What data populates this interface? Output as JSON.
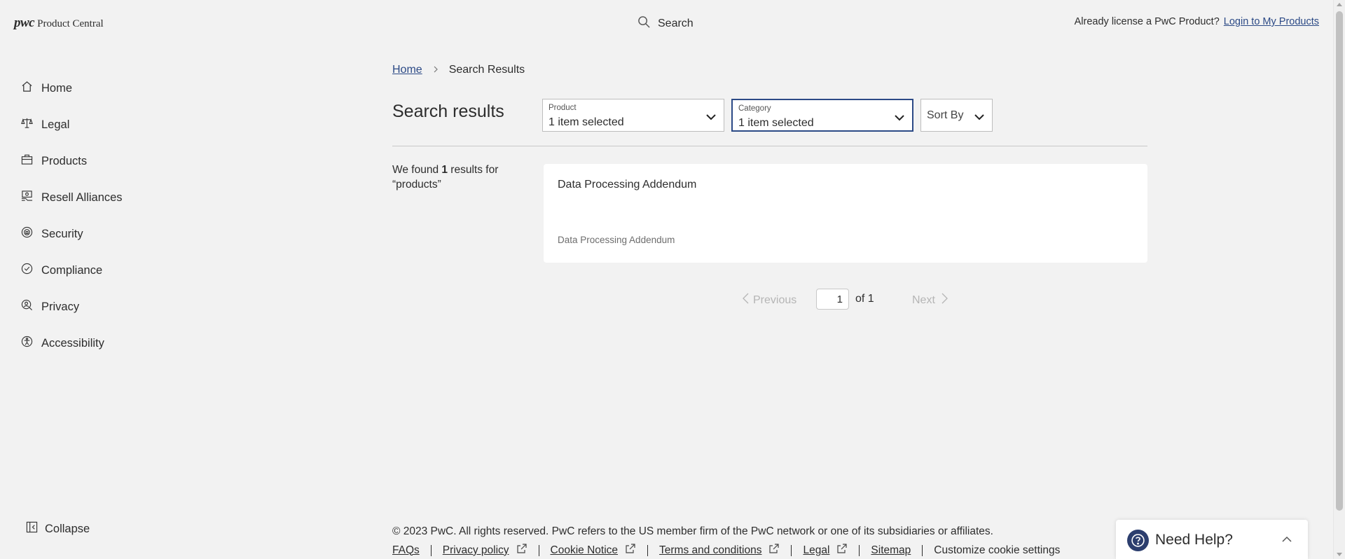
{
  "header": {
    "logo_mark": "pwc",
    "logo_text": "Product Central",
    "search_label": "Search",
    "license_prompt": "Already license a PwC Product?",
    "login_link": "Login to My Products"
  },
  "sidebar": {
    "items": [
      {
        "label": "Home",
        "icon": "home-icon"
      },
      {
        "label": "Legal",
        "icon": "scale-icon"
      },
      {
        "label": "Products",
        "icon": "briefcase-icon"
      },
      {
        "label": "Resell Alliances",
        "icon": "handshake-icon"
      },
      {
        "label": "Security",
        "icon": "shield-icon"
      },
      {
        "label": "Compliance",
        "icon": "check-circle-icon"
      },
      {
        "label": "Privacy",
        "icon": "user-search-icon"
      },
      {
        "label": "Accessibility",
        "icon": "accessibility-icon"
      }
    ],
    "collapse_label": "Collapse"
  },
  "breadcrumb": {
    "home": "Home",
    "current": "Search Results"
  },
  "results": {
    "title": "Search results",
    "filters": {
      "product": {
        "label": "Product",
        "value": "1 item selected"
      },
      "category": {
        "label": "Category",
        "value": "1 item selected"
      },
      "sort": {
        "label": "Sort By"
      }
    },
    "found_prefix": "We found ",
    "found_count": "1",
    "found_suffix": " results for",
    "query": "“products”",
    "items": [
      {
        "title": "Data Processing Addendum",
        "subtitle": "Data Processing Addendum"
      }
    ]
  },
  "pagination": {
    "previous": "Previous",
    "current_page": "1",
    "of_label": "of 1",
    "next": "Next"
  },
  "footer": {
    "copyright": "© 2023 PwC. All rights reserved. PwC refers to the US member firm of the PwC network or one of its subsidiaries or affiliates.",
    "links": {
      "faqs": "FAQs",
      "privacy": "Privacy policy",
      "cookie": "Cookie Notice",
      "terms": "Terms and conditions",
      "legal": "Legal",
      "sitemap": "Sitemap",
      "cookie_settings": "Customize cookie settings"
    }
  },
  "help": {
    "label": "Need Help?"
  },
  "colors": {
    "background": "#f2f2f2",
    "link": "#2c4a86",
    "help_icon_bg": "#2c3e6e",
    "disabled_text": "#b5b5b5"
  }
}
